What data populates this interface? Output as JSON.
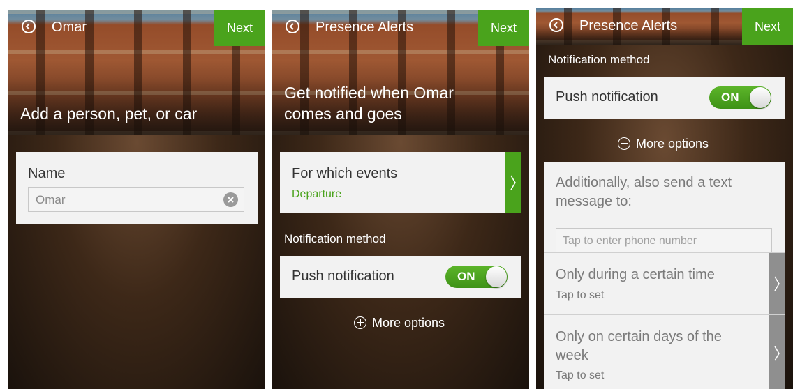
{
  "screen1": {
    "title": "Omar",
    "next_label": "Next",
    "headline": "Add a person, pet, or car",
    "name_label": "Name",
    "name_value": "Omar"
  },
  "screen2": {
    "title": "Presence Alerts",
    "next_label": "Next",
    "headline_line1": "Get notified when Omar",
    "headline_line2": "comes and goes",
    "events_label": "For which events",
    "events_value": "Departure",
    "notification_method_label": "Notification method",
    "push_label": "Push notification",
    "toggle_label": "ON",
    "more_options_label": "More options"
  },
  "screen3": {
    "title": "Presence Alerts",
    "next_label": "Next",
    "notification_method_label": "Notification method",
    "push_label": "Push notification",
    "toggle_label": "ON",
    "more_options_label": "More options",
    "sms_label_line1": "Additionally, also send a text",
    "sms_label_line2": "message to:",
    "phone_placeholder": "Tap to enter phone number",
    "time_label": "Only during a certain time",
    "time_value": "Tap to set",
    "days_label_line1": "Only on certain days of the",
    "days_label_line2": "week",
    "days_value": "Tap to set"
  },
  "colors": {
    "accent_green": "#4aa31c",
    "card_bg": "#f2f2f2",
    "disabled_tab": "#8f8f8f"
  }
}
